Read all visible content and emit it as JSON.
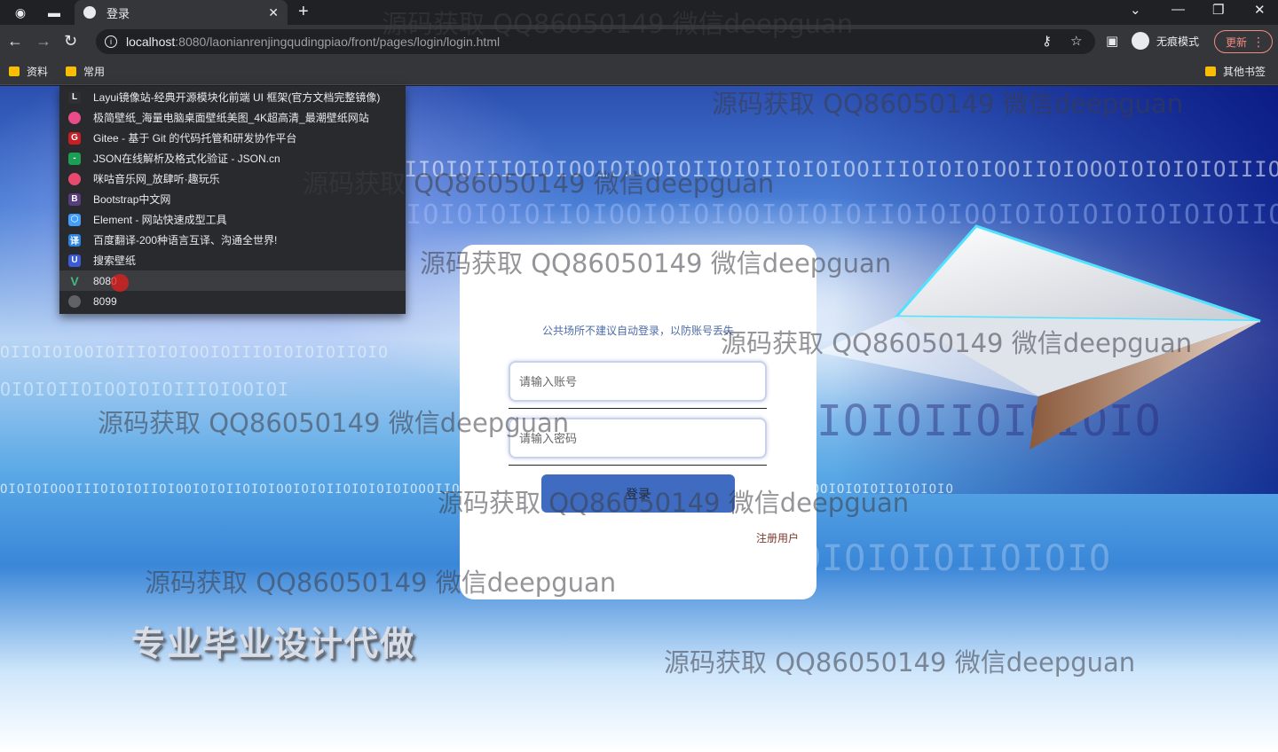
{
  "browser": {
    "tab_title": "登录",
    "new_tab_symbol": "+",
    "tab_close_symbol": "✕",
    "url_host": "localhost",
    "url_path": ":8080/laonianrenjingqudingpiao/front/pages/login/login.html",
    "incognito_label": "无痕模式",
    "update_label": "更新",
    "bookmarks": [
      {
        "label": "资料"
      },
      {
        "label": "常用"
      }
    ],
    "other_bookmarks_label": "其他书签",
    "dropdown_items": [
      {
        "label": "Layui镜像站-经典开源模块化前端 UI 框架(官方文档完整镜像)",
        "icon": "layui-icon",
        "color": "#2f3033"
      },
      {
        "label": "极简壁纸_海量电脑桌面壁纸美图_4K超高清_最潮壁纸网站",
        "icon": "wallpaper-icon",
        "color": "#ea4c89"
      },
      {
        "label": "Gitee - 基于 Git 的代码托管和研发协作平台",
        "icon": "gitee-icon",
        "color": "#c71d23"
      },
      {
        "label": "JSON在线解析及格式化验证 - JSON.cn",
        "icon": "json-icon",
        "color": "#1a9f55"
      },
      {
        "label": "咪咕音乐网_放肆听·趣玩乐",
        "icon": "migu-icon",
        "color": "#e84a6f"
      },
      {
        "label": "Bootstrap中文网",
        "icon": "bootstrap-icon",
        "color": "#563d7c"
      },
      {
        "label": "Element - 网站快速成型工具",
        "icon": "element-icon",
        "color": "#409eff"
      },
      {
        "label": "百度翻译-200种语言互译、沟通全世界!",
        "icon": "baidu-translate-icon",
        "color": "#2b85e4"
      },
      {
        "label": "搜索壁纸",
        "icon": "search-wallpaper-icon",
        "color": "#3b5bdb"
      },
      {
        "label": "8080",
        "icon": "vue-icon",
        "color": "#41b883"
      },
      {
        "label": "8099",
        "icon": "globe-icon",
        "color": "#5f6368"
      }
    ]
  },
  "login": {
    "hint": "公共场所不建议自动登录，以防账号丢失",
    "account_placeholder": "请输入账号",
    "password_placeholder": "请输入密码",
    "login_button": "登录",
    "register_link": "注册用户"
  },
  "slogan": "专业毕业设计代做",
  "watermark_text": "源码获取 QQ86050149 微信deepguan"
}
